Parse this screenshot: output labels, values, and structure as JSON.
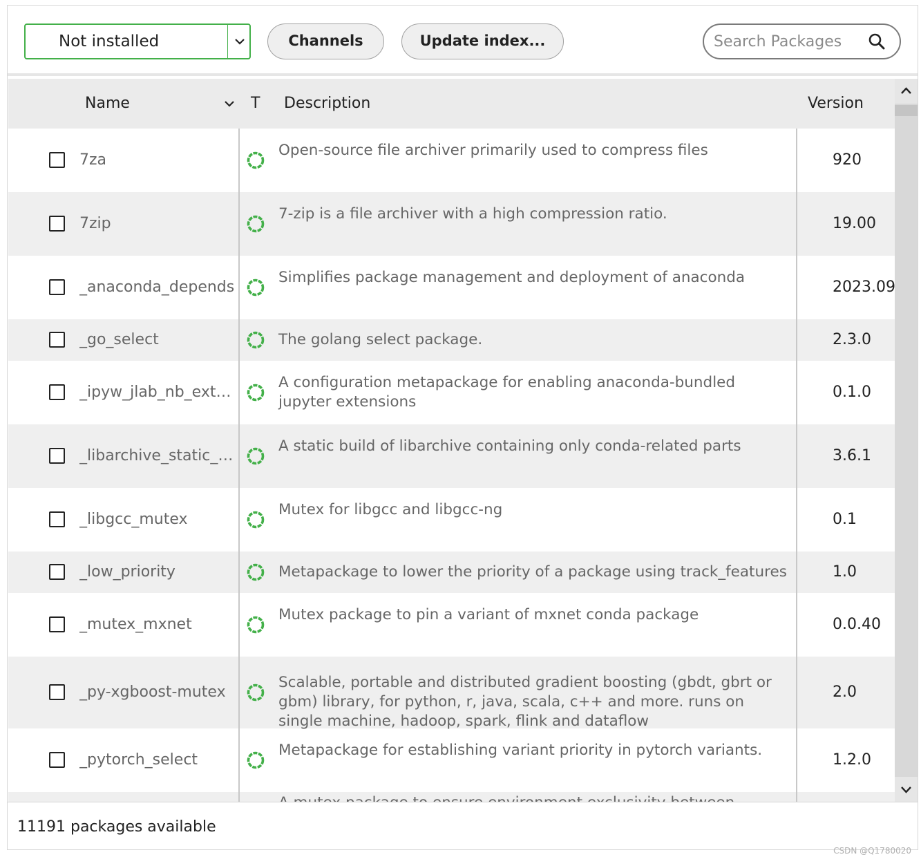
{
  "toolbar": {
    "filter_value": "Not installed",
    "channels_label": "Channels",
    "update_index_label": "Update index...",
    "search_placeholder": "Search Packages"
  },
  "table": {
    "headers": {
      "name": "Name",
      "type": "T",
      "description": "Description",
      "version": "Version"
    },
    "rows": [
      {
        "name": "7za",
        "description": "Open-source file archiver primarily used to compress files",
        "version": "920"
      },
      {
        "name": "7zip",
        "description": "7-zip is a file archiver with a high compression ratio.",
        "version": "19.00"
      },
      {
        "name": "_anaconda_depends",
        "description": "Simplifies package management and deployment of anaconda",
        "version": "2023.09"
      },
      {
        "name": "_go_select",
        "description": "The golang select package.",
        "version": "2.3.0"
      },
      {
        "name": "_ipyw_jlab_nb_ext…",
        "description": "A configuration metapackage for enabling anaconda-bundled jupyter extensions",
        "version": "0.1.0"
      },
      {
        "name": "_libarchive_static_f…",
        "description": "A static build of libarchive containing only conda-related parts",
        "version": "3.6.1"
      },
      {
        "name": "_libgcc_mutex",
        "description": "Mutex for libgcc and libgcc-ng",
        "version": "0.1"
      },
      {
        "name": "_low_priority",
        "description": "Metapackage to lower the priority of a package using track_features",
        "version": "1.0"
      },
      {
        "name": "_mutex_mxnet",
        "description": "Mutex package to pin a variant of mxnet conda package",
        "version": "0.0.40"
      },
      {
        "name": "_py-xgboost-mutex",
        "description": "Scalable, portable and distributed gradient boosting (gbdt, gbrt or gbm) library, for python, r, java, scala, c++ and more. runs on single machine, hadoop, spark, flink and dataflow",
        "version": "2.0"
      },
      {
        "name": "_pytorch_select",
        "description": "Metapackage for establishing variant priority in pytorch variants.",
        "version": "1.2.0"
      },
      {
        "name": "",
        "description": "A mutex package to ensure environment exclusivity between",
        "version": ""
      }
    ]
  },
  "statusbar": {
    "count_text": "11191 packages available"
  },
  "watermark": "CSDN @Q1780020",
  "colors": {
    "accent_green": "#43b049",
    "header_bg": "#ebebeb",
    "alt_row_bg": "#efefef"
  },
  "icons": {
    "filter_dropdown": "chevron-down-icon",
    "search": "search-icon",
    "sort": "chevron-down-icon",
    "status": "package-status-icon",
    "scroll_up": "chevron-up-icon",
    "scroll_down": "chevron-down-icon"
  }
}
